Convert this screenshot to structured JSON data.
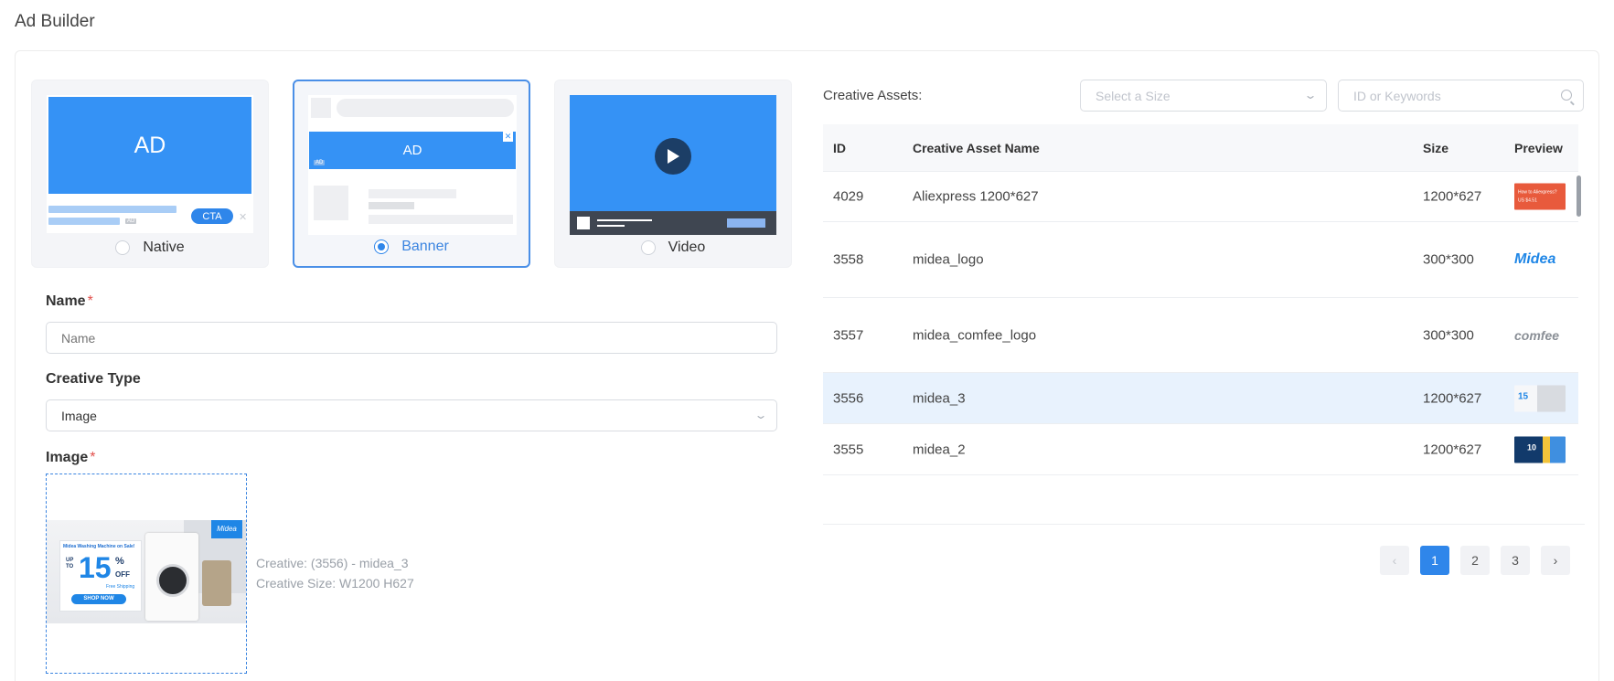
{
  "page": {
    "title": "Ad Builder"
  },
  "formats": [
    {
      "label": "Native",
      "selected": false,
      "illustration": {
        "ad_text": "AD",
        "cta_text": "CTA",
        "badge": "AD"
      }
    },
    {
      "label": "Banner",
      "selected": true,
      "illustration": {
        "ad_text": "AD",
        "badge": "AD"
      }
    },
    {
      "label": "Video",
      "selected": false
    }
  ],
  "form": {
    "name": {
      "label": "Name",
      "required_mark": "*",
      "placeholder": "Name",
      "value": ""
    },
    "creative_type": {
      "label": "Creative Type",
      "value": "Image"
    },
    "image": {
      "label": "Image",
      "required_mark": "*",
      "creative_line": "Creative: (3556) - midea_3",
      "size_line": "Creative Size: W1200 H627",
      "preview": {
        "headline": "Midea Washing Machine on Sale!",
        "up_to": "UP TO",
        "percent": "15",
        "percent_sign": "%",
        "off": "OFF",
        "free_shipping": "Free Shipping",
        "cta": "SHOP NOW",
        "brand": "Midea"
      }
    }
  },
  "assets": {
    "label": "Creative Assets:",
    "size_select_placeholder": "Select a Size",
    "search_placeholder": "ID or Keywords",
    "columns": {
      "id": "ID",
      "name": "Creative Asset Name",
      "size": "Size",
      "preview": "Preview"
    },
    "rows": [
      {
        "id": "4029",
        "name": "Aliexpress 1200*627",
        "size": "1200*627",
        "preview_text": "How to Aliexpress? US $4.51",
        "highlighted": false
      },
      {
        "id": "3558",
        "name": "midea_logo",
        "size": "300*300",
        "preview_text": "Midea",
        "highlighted": false
      },
      {
        "id": "3557",
        "name": "midea_comfee_logo",
        "size": "300*300",
        "preview_text": "comfee",
        "highlighted": false
      },
      {
        "id": "3556",
        "name": "midea_3",
        "size": "1200*627",
        "preview_text": "15",
        "highlighted": true
      },
      {
        "id": "3555",
        "name": "midea_2",
        "size": "1200*627",
        "preview_text": "10",
        "highlighted": false
      }
    ],
    "pagination": {
      "prev": "‹",
      "pages": [
        "1",
        "2",
        "3"
      ],
      "current": "1",
      "next": "›"
    }
  },
  "colors": {
    "accent": "#2f86ea",
    "ad_blue": "#3592f5",
    "required": "#e2504c",
    "highlight_row": "#e8f2fd"
  }
}
